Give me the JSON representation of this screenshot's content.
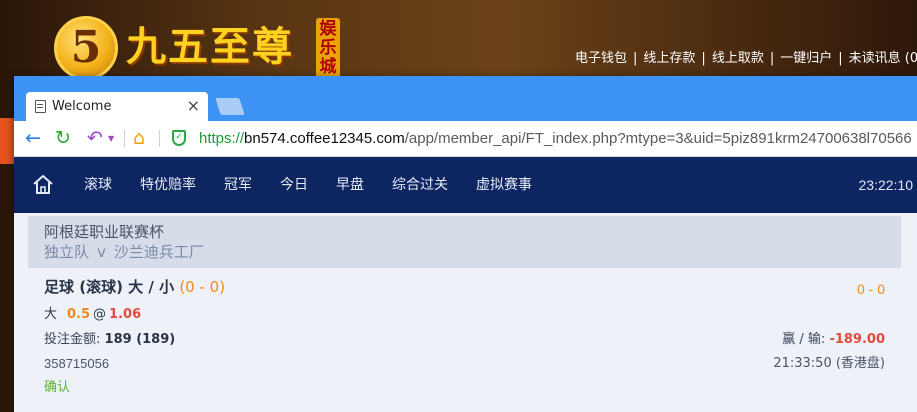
{
  "background_site": {
    "logo_glyph": "5",
    "logo_text": "九五至尊",
    "logo_badge": "娱乐城",
    "nav": [
      "电子钱包",
      "线上存款",
      "线上取款",
      "一键归户",
      "未读讯息 (0"
    ],
    "nav_separator": "|"
  },
  "browser": {
    "tab_title": "Welcome",
    "tab_close_icon": "×",
    "url_scheme": "https://",
    "url_host": "bn574.coffee12345.com",
    "url_path": "/app/member_api/FT_index.php?mtype=3&uid=5piz891krm24700638l70566"
  },
  "navbar": {
    "items": [
      "滚球",
      "特优赔率",
      "冠军",
      "今日",
      "早盘",
      "综合过关",
      "虚拟赛事"
    ],
    "time": "23:22:10"
  },
  "match": {
    "league": "阿根廷职业联赛杯",
    "home_team": "独立队",
    "vs": "v",
    "away_team": "沙兰迪兵工厂"
  },
  "bet": {
    "title": "足球 (滚球) 大 / 小",
    "score": "(0 - 0)",
    "score_right": "0 - 0",
    "pick": "大",
    "handicap": "0.5",
    "at": "@",
    "odds": "1.06",
    "amount_label": "投注金额:",
    "amount_value": "189 (189)",
    "winloss_label": "赢 / 输:",
    "winloss_value": "-189.00",
    "ticket_id": "358715056",
    "ticket_time": "21:33:50 (香港盘)",
    "status": "确认"
  },
  "colors": {
    "navbar_bg": "#0d2560",
    "tabstrip_bg": "#3c93f4",
    "accent_orange": "#ee8a1a",
    "accent_red": "#e24b3b",
    "status_green": "#57b43a"
  }
}
